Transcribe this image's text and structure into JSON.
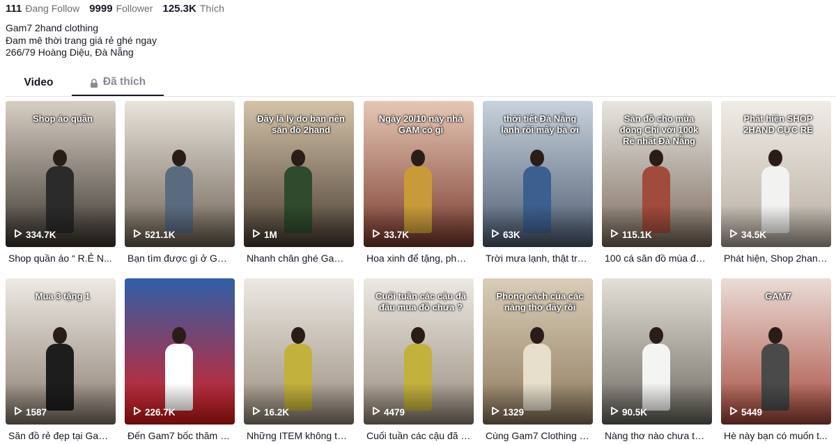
{
  "profile": {
    "following_count": "111",
    "following_label": "Đang Follow",
    "followers_count": "9999",
    "followers_label": "Follower",
    "likes_count": "125.3K",
    "likes_label": "Thích",
    "bio_lines": [
      "Gam7 2hand clothing",
      "Đam mê thời trang giá rẻ ghé ngay",
      "266/79 Hoàng Diệu, Đà Nẵng"
    ]
  },
  "tabs": [
    {
      "label": "Video",
      "active": true
    },
    {
      "label": "Đã thích",
      "locked": true,
      "icon": "lock-icon"
    }
  ],
  "videos": [
    {
      "views": "334.7K",
      "title": "Shop quần áo “ R.Ẻ N...",
      "overlay": "Shop áo quần",
      "bg": [
        "#d8cfc4",
        "#3c3630"
      ],
      "shirt": "#2b2b2b"
    },
    {
      "views": "521.1K",
      "title": "Bạn tìm được gì ở Gam...",
      "overlay": "",
      "bg": [
        "#e9e4dc",
        "#6e6254"
      ],
      "shirt": "#5a6b80"
    },
    {
      "views": "1M",
      "title": "Nhanh chân ghé Gam ...",
      "overlay": "Đây là lý do bạn nên săn đồ 2hand",
      "bg": [
        "#d4c3a9",
        "#4a3e33"
      ],
      "shirt": "#2f4a2c"
    },
    {
      "views": "33.7K",
      "title": "Hoa xinh để tặng, phụ ...",
      "overlay": "Ngày 20/10 này nhà GAM có gì",
      "bg": [
        "#e6c7b5",
        "#7a3b2e"
      ],
      "shirt": "#c99a3a"
    },
    {
      "views": "63K",
      "title": "Trời mưa lạnh, thật trù...",
      "overlay": "thời tiết Đà Nẵng lạnh rồi mấy bà ơi",
      "bg": [
        "#c8d2dc",
        "#4d5d72"
      ],
      "shirt": "#3d5f8f"
    },
    {
      "views": "115.1K",
      "title": "100 cá săn đồ mùa đô...",
      "overlay": "Săn đồ cho mùa đông Chỉ với 100k Rẻ nhất Đà Nẵng",
      "bg": [
        "#e8e6e1",
        "#7b6a5c"
      ],
      "shirt": "#a14b3c"
    },
    {
      "views": "34.5K",
      "title": "Phát hiện, Shop 2hand...",
      "overlay": "Phát hiện SHOP 2HAND CỰC RẺ",
      "bg": [
        "#f0ece6",
        "#b8aea2"
      ],
      "shirt": "#f2f2f0"
    },
    {
      "views": "1587",
      "title": "Săn đồ rẻ đẹp tại Gam...",
      "overlay": "Mua 3 tặng 1",
      "bg": [
        "#eeeae4",
        "#8a7d70"
      ],
      "shirt": "#1d1d1d"
    },
    {
      "views": "226.7K",
      "title": "Đến Gam7 bốc thăm tr...",
      "overlay": "",
      "bg": [
        "#2f5fa8",
        "#e21d1d"
      ],
      "shirt": "#ffffff"
    },
    {
      "views": "16.2K",
      "title": "Những ITEM không thể...",
      "overlay": "",
      "bg": [
        "#ece9e3",
        "#9a8c7c"
      ],
      "shirt": "#c2b13c"
    },
    {
      "views": "4479",
      "title": "Cuối tuần các cậu đã b...",
      "overlay": "Cuối tuần các cậu đã đâu mua đồ chưa ?",
      "bg": [
        "#ece9e3",
        "#9a8c7c"
      ],
      "shirt": "#c2b13c"
    },
    {
      "views": "1329",
      "title": "Cùng Gam7 Clothing p...",
      "overlay": "Phong cách của các nàng thơ đây rồi",
      "bg": [
        "#d9cdb8",
        "#8f7b5e"
      ],
      "shirt": "#e7dfcc"
    },
    {
      "views": "90.5K",
      "title": "Nàng thơ nào chưa tới ...",
      "overlay": "",
      "bg": [
        "#e4e0d8",
        "#6e6a62"
      ],
      "shirt": "#f4f4f2"
    },
    {
      "views": "5449",
      "title": "Hè này bạn có muốn t...",
      "overlay": "GAM7",
      "bg": [
        "#eadcd6",
        "#a84b3e"
      ],
      "shirt": "#4a4a4a"
    }
  ],
  "icons": {
    "play": "play-icon",
    "lock": "lock-icon"
  }
}
